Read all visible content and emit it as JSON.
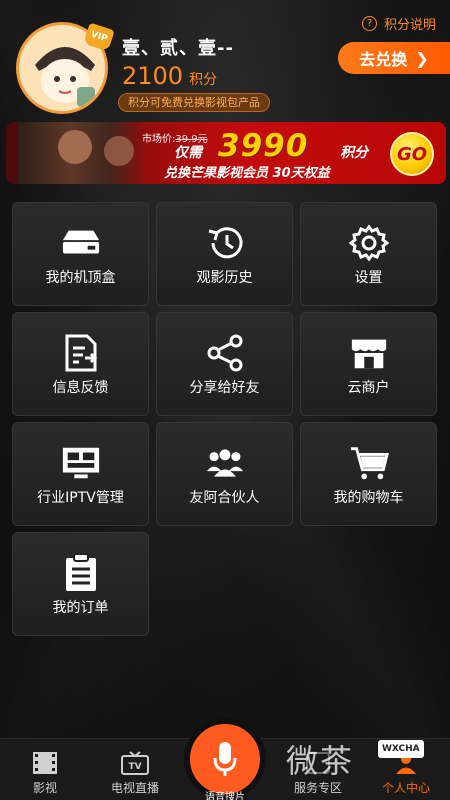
{
  "profile": {
    "vip_badge": "VIP",
    "username": "壹、贰、壹--",
    "points_value": "2100",
    "points_unit": "积分",
    "points_note": "积分可免费兑换影视包产品",
    "points_help": "积分说明",
    "redeem_label": "去兑换"
  },
  "banner": {
    "market_prefix": "市场价:",
    "market_price": "39.9元",
    "need_label": "仅需",
    "price": "3990",
    "price_unit": "积分",
    "description": "兑换芒果影视会员 30天权益",
    "go_label": "GO"
  },
  "grid": {
    "items": [
      {
        "label": "我的机顶盒",
        "icon": "set-top-box-icon"
      },
      {
        "label": "观影历史",
        "icon": "history-icon"
      },
      {
        "label": "设置",
        "icon": "gear-icon"
      },
      {
        "label": "信息反馈",
        "icon": "feedback-icon"
      },
      {
        "label": "分享给好友",
        "icon": "share-icon"
      },
      {
        "label": "云商户",
        "icon": "store-icon"
      },
      {
        "label": "行业IPTV管理",
        "icon": "iptv-monitor-icon"
      },
      {
        "label": "友阿合伙人",
        "icon": "partners-icon"
      },
      {
        "label": "我的购物车",
        "icon": "cart-icon"
      },
      {
        "label": "我的订单",
        "icon": "clipboard-icon"
      }
    ]
  },
  "tabbar": {
    "tabs": [
      {
        "label": "影视",
        "icon": "film-icon"
      },
      {
        "label": "电视直播",
        "icon": "tv-icon"
      },
      {
        "label": "服务专区",
        "icon": "service-icon"
      },
      {
        "label": "个人中心",
        "icon": "user-icon"
      }
    ],
    "voice_label": "语音搜片",
    "tv_glyph": "TV"
  },
  "watermark": {
    "text": "微茶",
    "badge": "WXCHA"
  },
  "colors": {
    "accent": "#ff6a00",
    "banner_red": "#c40c0c",
    "price_yellow": "#ffd200"
  }
}
